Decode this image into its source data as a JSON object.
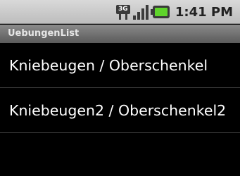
{
  "status_bar": {
    "network_label": "3G",
    "time": "1:41 PM",
    "icons": [
      "3g-data-icon",
      "signal-strength-icon",
      "battery-charging-icon"
    ]
  },
  "app": {
    "title": "UebungenList"
  },
  "list": {
    "items": [
      {
        "label": "Kniebeugen / Oberschenkel"
      },
      {
        "label": "Kniebeugen2 / Oberschenkel2"
      }
    ]
  },
  "colors": {
    "battery_charge": "#5fd42b",
    "background": "#000000"
  }
}
